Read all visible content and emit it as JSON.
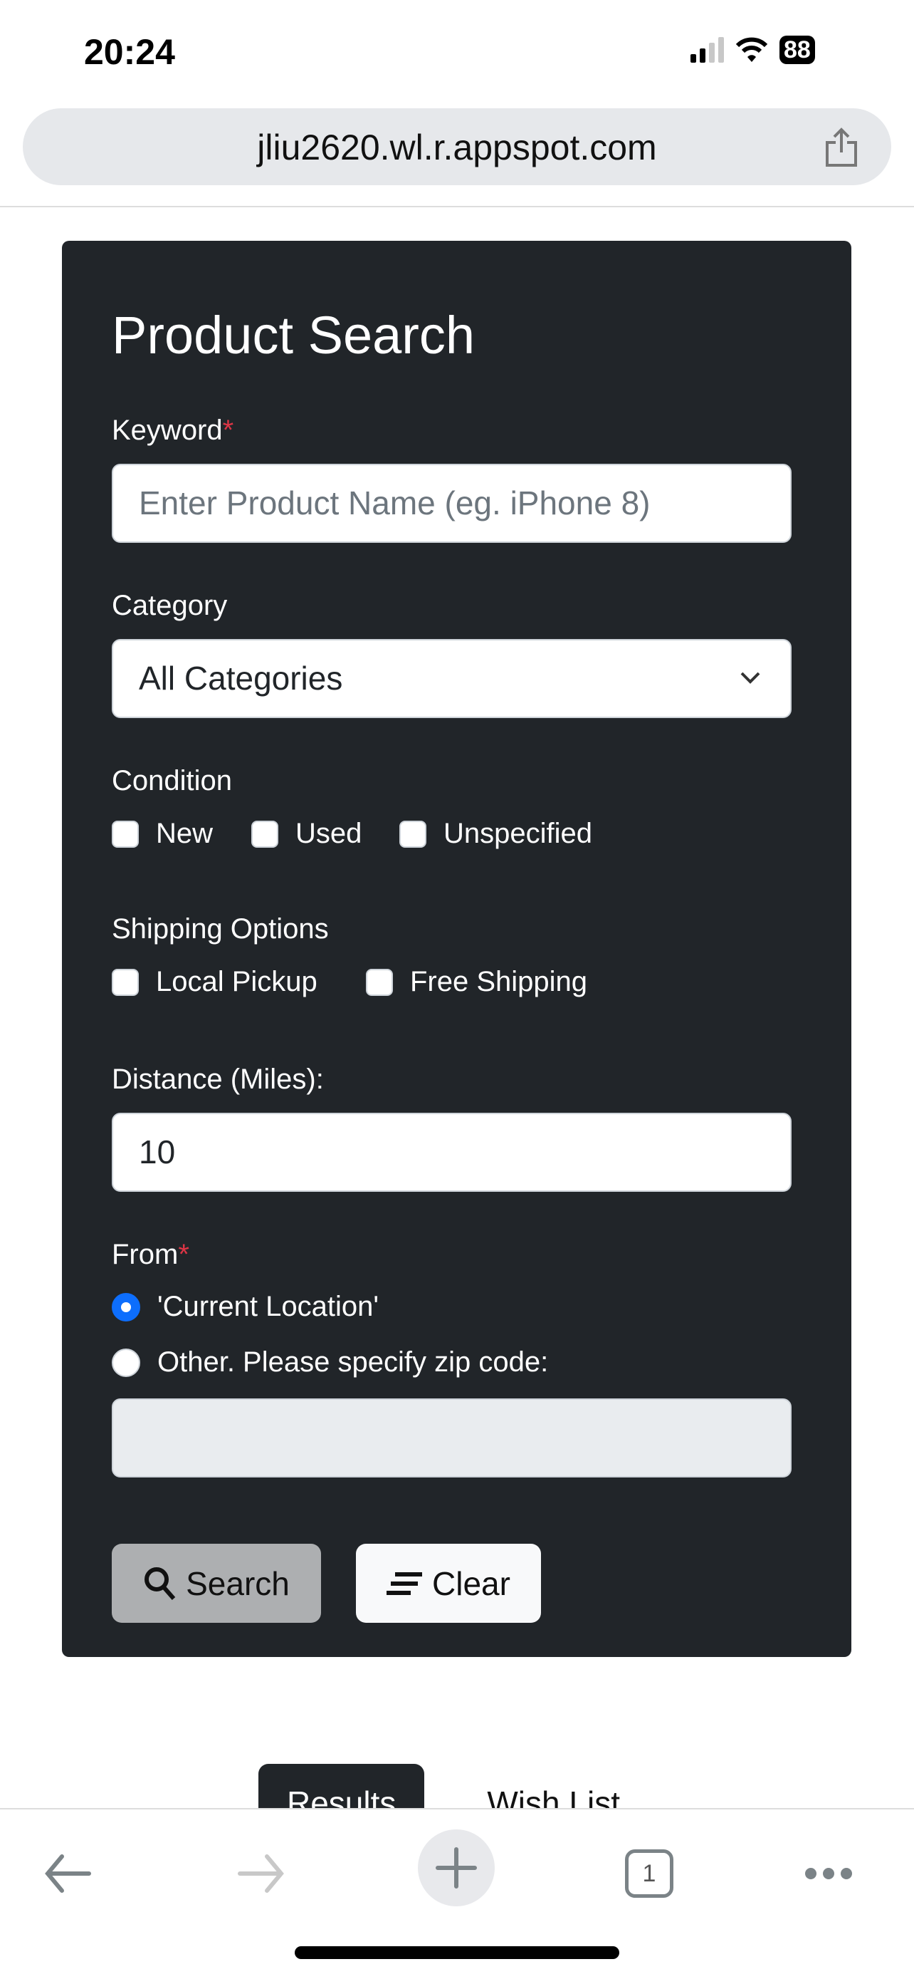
{
  "status_bar": {
    "time": "20:24",
    "battery": "88"
  },
  "browser": {
    "url": "jliu2620.wl.r.appspot.com",
    "tab_count": "1"
  },
  "form": {
    "title": "Product Search",
    "keyword": {
      "label": "Keyword",
      "required": "*",
      "placeholder": "Enter Product Name (eg. iPhone 8)",
      "value": ""
    },
    "category": {
      "label": "Category",
      "selected": "All Categories"
    },
    "condition": {
      "label": "Condition",
      "options": [
        {
          "label": "New",
          "checked": false
        },
        {
          "label": "Used",
          "checked": false
        },
        {
          "label": "Unspecified",
          "checked": false
        }
      ]
    },
    "shipping": {
      "label": "Shipping Options",
      "options": [
        {
          "label": "Local Pickup",
          "checked": false
        },
        {
          "label": "Free Shipping",
          "checked": false
        }
      ]
    },
    "distance": {
      "label": "Distance (Miles):",
      "value": "10"
    },
    "from": {
      "label": "From",
      "required": "*",
      "options": [
        {
          "label": "'Current Location'",
          "selected": true
        },
        {
          "label": "Other. Please specify zip code:",
          "selected": false
        }
      ],
      "zip_value": ""
    },
    "search_label": "Search",
    "clear_label": "Clear"
  },
  "tabs": [
    {
      "label": "Results",
      "active": true
    },
    {
      "label": "Wish List",
      "active": false
    }
  ],
  "colors": {
    "panel": "#212529",
    "accent": "#0d6efd",
    "required": "#dc3545"
  }
}
